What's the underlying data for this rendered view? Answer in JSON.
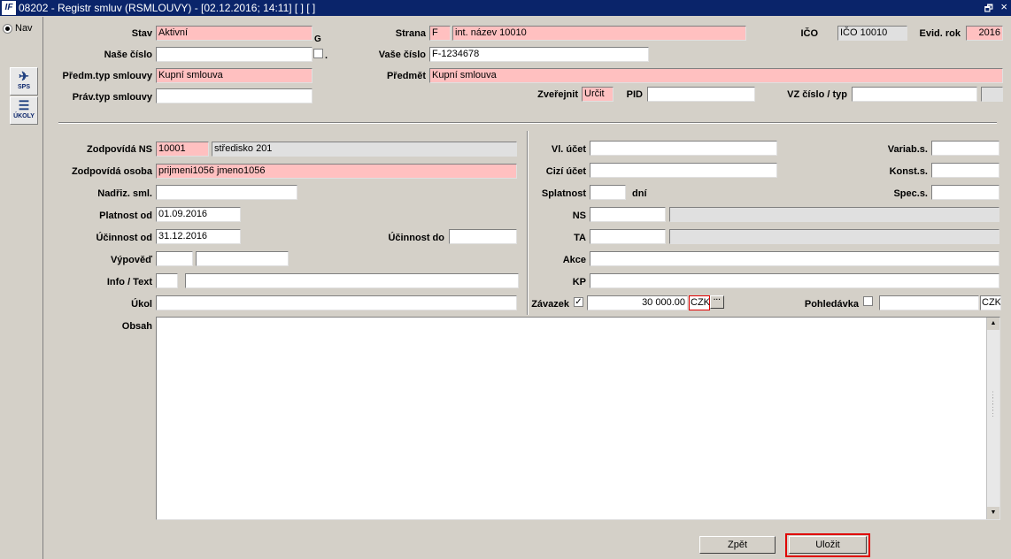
{
  "window": {
    "title": "08202 - Registr smluv (RSMLOUVY) - [02.12.2016; 14:11] [ ] [ ]",
    "logo": "IF",
    "restore_glyph": "🗗",
    "close_glyph": "×"
  },
  "sidebar": {
    "nav_label": "Nav",
    "sps_label": "SPS",
    "ukoly_label": "ÚKOLY"
  },
  "top": {
    "stav_label": "Stav",
    "stav_value": "Aktivní",
    "g_label": "G",
    "nase_cislo_label": "Naše číslo",
    "nase_cislo_value": "",
    "dot_label": ".",
    "predm_typ_label": "Předm.typ smlouvy",
    "predm_typ_value": "Kupní smlouva",
    "prav_typ_label": "Práv.typ smlouvy",
    "prav_typ_value": "",
    "strana_label": "Strana",
    "strana_code": "F",
    "strana_name": "int. název 10010",
    "vase_cislo_label": "Vaše číslo",
    "vase_cislo_value": "F-1234678",
    "predmet_label": "Předmět",
    "predmet_value": "Kupní smlouva",
    "zverejnit_label": "Zveřejnit",
    "zverejnit_value": "Určit",
    "pid_label": "PID",
    "pid_value": "",
    "ico_label": "IČO",
    "ico_value": "IČO 10010",
    "evid_rok_label": "Evid. rok",
    "evid_rok_value": "2016",
    "vz_label": "VZ číslo / typ",
    "vz_value": "",
    "vz_type": ""
  },
  "left": {
    "zodp_ns_label": "Zodpovídá NS",
    "zodp_ns_code": "10001",
    "zodp_ns_name": "středisko 201",
    "zodp_osoba_label": "Zodpovídá osoba",
    "zodp_osoba_value": "prijmeni1056 jmeno1056",
    "nadriz_label": "Nadřiz. sml.",
    "nadriz_value": "",
    "platnost_label": "Platnost od",
    "platnost_value": "01.09.2016",
    "ucinnost_od_label": "Účinnost od",
    "ucinnost_od_value": "31.12.2016",
    "ucinnost_do_label": "Účinnost do",
    "ucinnost_do_value": "",
    "vypoved_label": "Výpověď",
    "vypoved_a": "",
    "vypoved_b": "",
    "info_label": "Info / Text",
    "info_a": "",
    "info_b": "",
    "ukol_label": "Úkol",
    "ukol_value": "",
    "obsah_label": "Obsah",
    "obsah_value": ""
  },
  "right": {
    "vl_ucet_label": "Vl. účet",
    "vl_ucet_value": "",
    "cizi_ucet_label": "Cizí účet",
    "cizi_ucet_value": "",
    "splatnost_label": "Splatnost",
    "splatnost_value": "",
    "dni_label": "dní",
    "ns_label": "NS",
    "ns_code": "",
    "ns_name": "",
    "ta_label": "TA",
    "ta_code": "",
    "ta_name": "",
    "akce_label": "Akce",
    "akce_value": "",
    "kp_label": "KP",
    "kp_value": "",
    "variab_label": "Variab.s.",
    "variab_value": "",
    "konst_label": "Konst.s.",
    "konst_value": "",
    "spec_label": "Spec.s.",
    "spec_value": "",
    "zavazek_label": "Závazek",
    "zavazek_checked": "✓",
    "zavazek_amount": "30 000.00",
    "zavazek_currency": "CZK",
    "dots": "···",
    "pohledavka_label": "Pohledávka",
    "pohledavka_amount": "",
    "pohledavka_currency": "CZK"
  },
  "buttons": {
    "zpet_label": "Zpět",
    "ulozit_label": "Uložit"
  },
  "colors": {
    "required_bg": "#ffc0c0",
    "titlebar_bg": "#0a246a",
    "highlight": "#e00000"
  }
}
